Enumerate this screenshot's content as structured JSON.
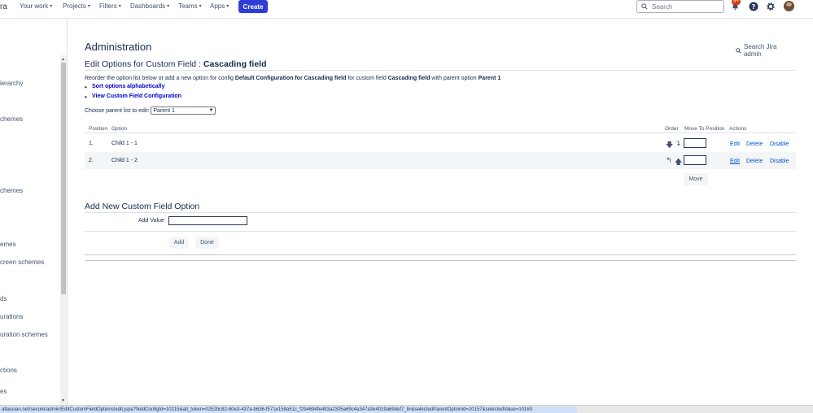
{
  "topnav": {
    "logo_fragment": "ra",
    "items": [
      "Your work",
      "Filters",
      "Projects",
      "Dashboards",
      "Teams",
      "Apps"
    ],
    "create_label": "Create",
    "search_placeholder": "Search",
    "notifications_badge": "9+"
  },
  "sidebar": {
    "items": [
      "ierarchy",
      "chemes",
      "chemes",
      "emes",
      "creen schemes",
      "ds",
      "urations",
      "uration schemes",
      "ctions",
      "es"
    ]
  },
  "main": {
    "page_title": "Administration",
    "search_admin_label": "Search Jira admin",
    "section_title_prefix": "Edit Options for Custom Field :",
    "section_title_field": "Cascading field",
    "description": {
      "part1": "Reorder the option list below or add a new option for config",
      "config_name": "Default Configuration for Cascading field",
      "part2": "for custom field",
      "field_name": "Cascading field",
      "part3": "with parent option",
      "parent_name": "Parent 1"
    },
    "links": [
      "Sort options alphabetically",
      "View Custom Field Configuration"
    ],
    "choose_label": "Choose parent list to edit:",
    "parent_select_value": "Parent 1",
    "table": {
      "headers": {
        "position": "Position",
        "option": "Option",
        "order": "Order",
        "move_to": "Move To Position",
        "actions": "Actions"
      },
      "rows": [
        {
          "position": "1.",
          "option": "Child 1 - 1",
          "edit": "Edit",
          "delete": "Delete",
          "disable": "Disable"
        },
        {
          "position": "2.",
          "option": "Child 1 - 2",
          "edit": "Edit",
          "delete": "Delete",
          "disable": "Disable"
        }
      ],
      "move_button": "Move"
    },
    "add_section": {
      "title": "Add New Custom Field Option",
      "value_label": "Add Value",
      "add_button": "Add",
      "done_button": "Done"
    }
  },
  "statusbar": {
    "url": "atlassian.net/secure/admin/EditCustomFieldOptions!edit.jspa?fieldConfigId=10215&atl_token=0252bc82-60e3-437a-b636-f571e158a51c_f294694fe493a2305a69c4a347a3e4019a69def7_lin&selectedParentOptionId=10157&selectedValue=10160"
  }
}
